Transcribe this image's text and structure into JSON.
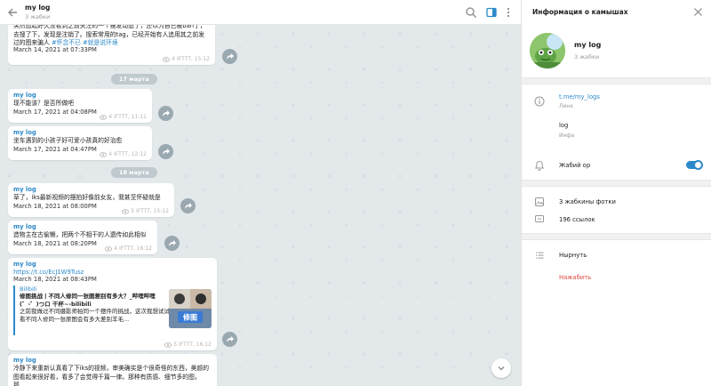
{
  "chat": {
    "title": "my log",
    "subtitle": "3 жабки"
  },
  "messages": [
    {
      "sender": "",
      "text": "突然想起好久没看到之前关注的一个推发动态了，还以为自己被ban了，去搜了下，发现是注销了。搜索常用的tag，已经开始有人追用其之前发过的图来骗人",
      "hashtags": "#怀念不已 #就是说环境",
      "date": "March 14, 2021 at 07:33PM",
      "views": "4",
      "via": "IFTTT, 15:12"
    },
    {
      "sender": "my log",
      "text": "现不能该？是否所做吧",
      "date": "March 17, 2021 at 04:08PM",
      "views": "4",
      "via": "IFTTT, 11:11"
    },
    {
      "sender": "my log",
      "text": "坐车遇到的小孩子好可爱小孩真的好治愈",
      "date": "March 17, 2021 at 04:47PM",
      "views": "4",
      "via": "IFTTT, 12:12"
    },
    {
      "sender": "my log",
      "text": "草了，iks最新视频的摆拍好像前女友，我甚至怀疑就是",
      "date": "March 18, 2021 at 08:00PM",
      "views": "5",
      "via": "IFTTT, 15:12"
    },
    {
      "sender": "my log",
      "text": "造物主在古偷懒，把两个不相干的人遗传如此相似",
      "date": "March 18, 2021 at 08:20PM",
      "views": "4",
      "via": "IFTTT, 16:12"
    },
    {
      "sender": "my log",
      "link": "https://t.co/EcJ1W9Tusz",
      "date": "March 18, 2021 at 08:43PM",
      "preview_site": "Bilibili",
      "preview_title": "修图挑战丨不同人修同一张图差别有多大？_哔哩哔哩 (゜-゜)つロ 干杯~-bilibili",
      "preview_desc": "之前我做过不同摄影师拍同一个摆件的挑战，这次我想试试看不同人修同一张原图会有多大差别羊毛...",
      "preview_badge": "修图",
      "views": "5",
      "via": "IFTTT, 16:12"
    },
    {
      "sender": "my log",
      "text": "冷静下来重新认真看了下iks的视频，审美确实是个很奇怪的东西，美颜的图看起来很好看，看多了会觉得千篇一律。那种有质感、细节多的图，那..."
    }
  ],
  "date_dividers": [
    "17 марта",
    "18 марта"
  ],
  "info_panel": {
    "title": "Информация о камышах",
    "name": "my log",
    "members": "3 жабки",
    "link": "t.me/my_logs",
    "link_hint": "Линк",
    "info_value": "log",
    "info_hint": "Инфа",
    "notifications_label": "Жабий ор",
    "notifications_on": true,
    "photos": "3 жабкины фотки",
    "links": "196 ссылок",
    "leave": "Нырнуть",
    "report": "Нажабить"
  },
  "colors": {
    "accent": "#2c89c9",
    "danger": "#e0463f",
    "chat_bg": "#e3e8eb"
  }
}
